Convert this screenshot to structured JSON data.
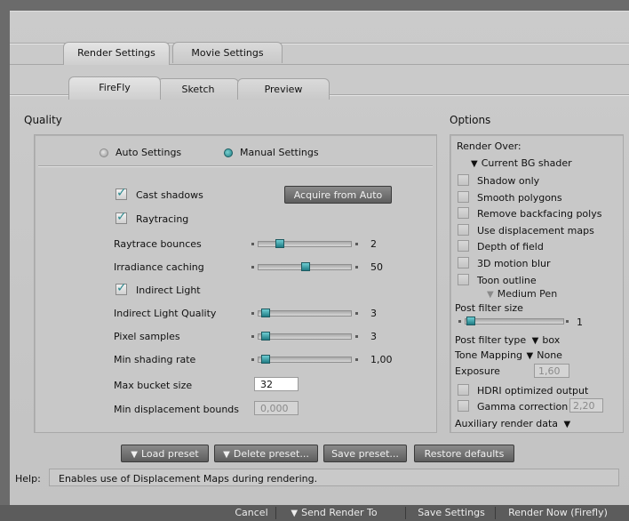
{
  "tabs": {
    "top": [
      "Render Settings",
      "Movie Settings"
    ],
    "sub": [
      "FireFly",
      "Sketch",
      "Preview"
    ]
  },
  "quality": {
    "title": "Quality",
    "auto_label": "Auto Settings",
    "manual_label": "Manual Settings",
    "mode_selected": "Manual Settings",
    "cast_shadows": {
      "label": "Cast shadows",
      "checked": true
    },
    "acquire_label": "Acquire from Auto",
    "raytracing": {
      "label": "Raytracing",
      "checked": true
    },
    "raytrace_bounces": {
      "label": "Raytrace bounces",
      "value": "2",
      "level": 0.2
    },
    "irradiance_caching": {
      "label": "Irradiance caching",
      "value": "50",
      "level": 0.5
    },
    "indirect_light": {
      "label": "Indirect Light",
      "checked": true
    },
    "indirect_light_quality": {
      "label": "Indirect Light Quality",
      "value": "3",
      "level": 0.03
    },
    "pixel_samples": {
      "label": "Pixel samples",
      "value": "3",
      "level": 0.03
    },
    "min_shading_rate": {
      "label": "Min shading rate",
      "value": "1,00",
      "level": 0.03
    },
    "max_bucket_size": {
      "label": "Max bucket size",
      "value": "32"
    },
    "min_displacement_bounds": {
      "label": "Min displacement bounds",
      "value": "0,000"
    }
  },
  "options": {
    "title": "Options",
    "render_over_label": "Render Over:",
    "render_over_value": "Current BG shader",
    "checks": [
      {
        "label": "Shadow only",
        "checked": false
      },
      {
        "label": "Smooth polygons",
        "checked": false
      },
      {
        "label": "Remove backfacing polys",
        "checked": false
      },
      {
        "label": "Use displacement maps",
        "checked": false
      },
      {
        "label": "Depth of field",
        "checked": false
      },
      {
        "label": "3D motion blur",
        "checked": false
      },
      {
        "label": "Toon outline",
        "checked": false
      }
    ],
    "toon_pen": "Medium Pen",
    "post_filter_size_label": "Post filter size",
    "post_filter_size_value": "1",
    "post_filter_type_label": "Post filter type",
    "post_filter_type_value": "box",
    "tone_mapping_label": "Tone Mapping",
    "tone_mapping_value": "None",
    "exposure_label": "Exposure",
    "exposure_value": "1,60",
    "hdri_label": "HDRI optimized output",
    "gamma_label": "Gamma correction",
    "gamma_value": "2,20",
    "aux_label": "Auxiliary render data"
  },
  "presets": {
    "load": "Load preset",
    "delete": "Delete preset...",
    "save": "Save preset...",
    "restore": "Restore defaults"
  },
  "help": {
    "label": "Help:",
    "text": "Enables use of Displacement Maps during rendering."
  },
  "footer": {
    "cancel": "Cancel",
    "send": "Send Render To",
    "save_settings": "Save Settings",
    "render_now": "Render Now (Firefly)"
  }
}
